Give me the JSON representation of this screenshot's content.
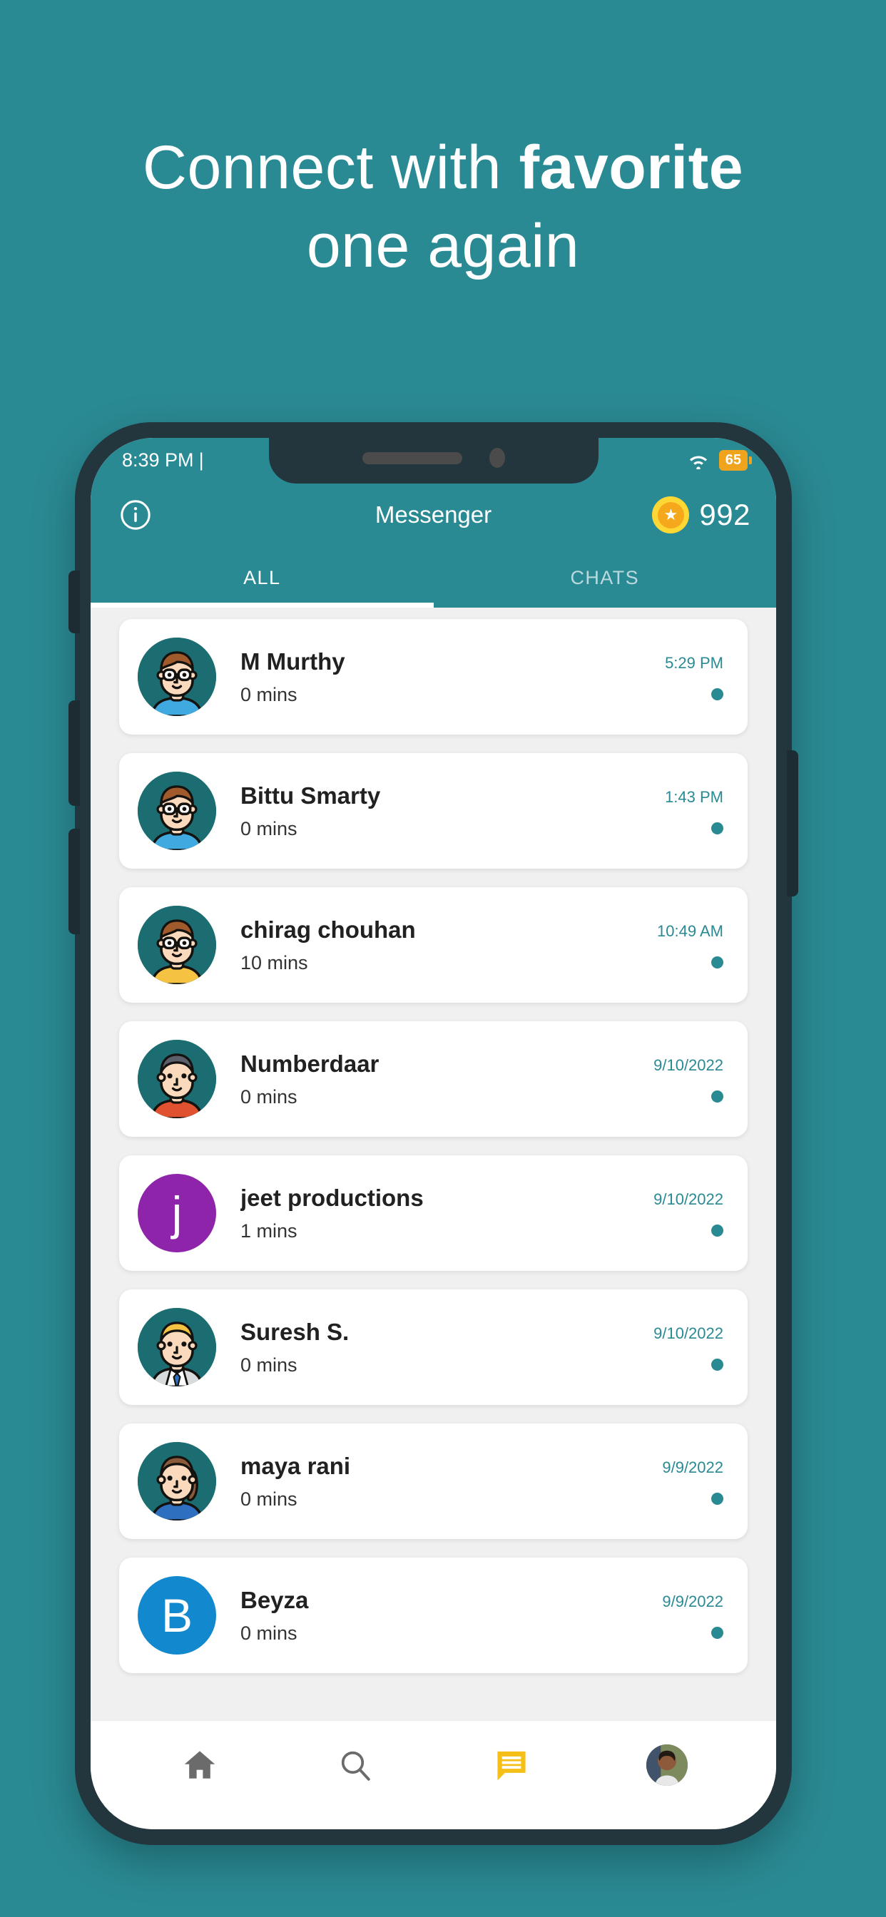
{
  "promo": {
    "line1_part1": "Connect with ",
    "line1_strong": "favorite",
    "line2": "one again"
  },
  "colors": {
    "brand_teal": "#2a8a94",
    "accent_yellow": "#fdd835",
    "coin_inner": "#f6a81c",
    "frame_dark": "#24363d",
    "list_bg": "#f0f0f0"
  },
  "statusbar": {
    "time": "8:39 PM",
    "time_suffix": "|",
    "wifi_icon": "wifi-icon",
    "battery_level": "65"
  },
  "appbar": {
    "info_icon": "info-circle-icon",
    "title": "Messenger",
    "coin_icon": "star-coin-icon",
    "coin_count": "992"
  },
  "tabs": [
    {
      "label": "ALL",
      "active": true
    },
    {
      "label": "CHATS",
      "active": false
    }
  ],
  "chats": [
    {
      "name": "M Murthy",
      "subtitle": "0 mins",
      "time": "5:29 PM",
      "unread": true,
      "avatar_type": "illustration",
      "avatar_variant": "glasses-blue",
      "avatar_bg": "#1c6d72"
    },
    {
      "name": "Bittu Smarty",
      "subtitle": "0 mins",
      "time": "1:43 PM",
      "unread": true,
      "avatar_type": "illustration",
      "avatar_variant": "glasses-blue",
      "avatar_bg": "#1c6d72"
    },
    {
      "name": "chirag chouhan",
      "subtitle": "10 mins",
      "time": "10:49 AM",
      "unread": true,
      "avatar_type": "illustration",
      "avatar_variant": "glasses-yellow",
      "avatar_bg": "#1c6d72"
    },
    {
      "name": "Numberdaar",
      "subtitle": "0 mins",
      "time": "9/10/2022",
      "unread": true,
      "avatar_type": "illustration",
      "avatar_variant": "dark-red",
      "avatar_bg": "#1c6d72"
    },
    {
      "name": "jeet productions",
      "subtitle": "1 mins",
      "time": "9/10/2022",
      "unread": true,
      "avatar_type": "letter",
      "avatar_letter": "j",
      "avatar_bg": "#8e24aa"
    },
    {
      "name": "Suresh S.",
      "subtitle": "0 mins",
      "time": "9/10/2022",
      "unread": true,
      "avatar_type": "illustration",
      "avatar_variant": "blond-tie",
      "avatar_bg": "#1c6d72"
    },
    {
      "name": "maya rani",
      "subtitle": "0 mins",
      "time": "9/9/2022",
      "unread": true,
      "avatar_type": "illustration",
      "avatar_variant": "woman-blue",
      "avatar_bg": "#1c6d72"
    },
    {
      "name": "Beyza",
      "subtitle": "0 mins",
      "time": "9/9/2022",
      "unread": true,
      "avatar_type": "letter",
      "avatar_letter": "B",
      "avatar_bg": "#1288ce"
    }
  ],
  "bottomnav": [
    {
      "icon": "home-icon",
      "active": false
    },
    {
      "icon": "search-icon",
      "active": false
    },
    {
      "icon": "message-icon",
      "active": true
    },
    {
      "icon": "profile-avatar-icon",
      "active": false
    }
  ]
}
